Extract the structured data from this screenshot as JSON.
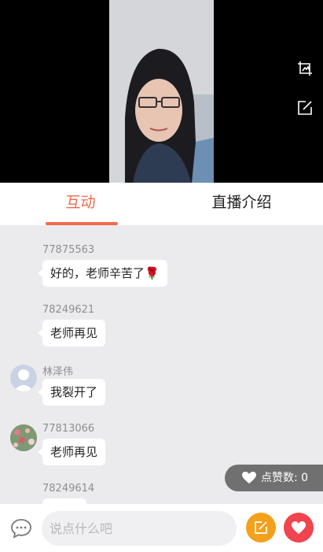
{
  "tabs": [
    {
      "label": "互动",
      "active": true
    },
    {
      "label": "直播介绍",
      "active": false
    }
  ],
  "messages": [
    {
      "user": "77875563",
      "text": "好的，老师辛苦了🌹",
      "avatar": "none"
    },
    {
      "user": "78249621",
      "text": "老师再见",
      "avatar": "none"
    },
    {
      "user": "林泽伟",
      "text": "我裂开了",
      "avatar": "default-avatar"
    },
    {
      "user": "77813066",
      "text": "老师再见",
      "avatar": "flower-avatar"
    },
    {
      "user": "78249614",
      "text": "",
      "avatar": "none"
    }
  ],
  "likes": {
    "label": "点赞数: 0"
  },
  "composer": {
    "placeholder": "说点什么吧"
  },
  "colors": {
    "accent": "#f06a4a",
    "edit_button": "#f3a11a",
    "heart_button": "#f0454f",
    "chat_background": "#ebebee"
  },
  "icons": [
    "screenshot-icon",
    "edit-icon",
    "heart-icon",
    "chat-bubble-icon"
  ]
}
